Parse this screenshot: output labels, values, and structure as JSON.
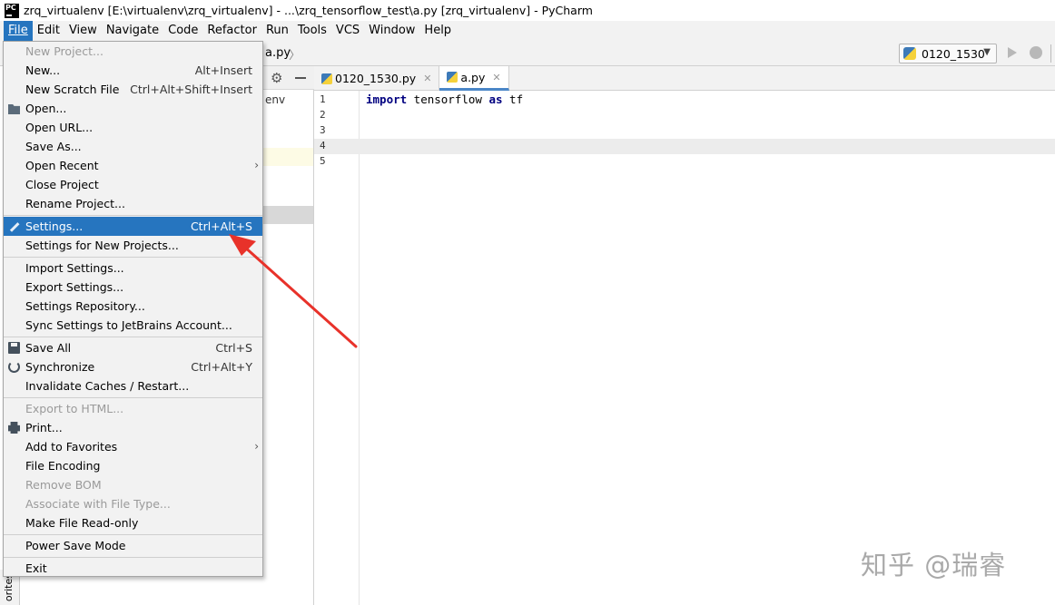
{
  "window": {
    "title": "zrq_virtualenv [E:\\virtualenv\\zrq_virtualenv] - ...\\zrq_tensorflow_test\\a.py [zrq_virtualenv] - PyCharm",
    "app_icon_text": "PC"
  },
  "menubar": {
    "items": [
      {
        "label": "File",
        "active": true
      },
      {
        "label": "Edit"
      },
      {
        "label": "View"
      },
      {
        "label": "Navigate"
      },
      {
        "label": "Code"
      },
      {
        "label": "Refactor"
      },
      {
        "label": "Run"
      },
      {
        "label": "Tools"
      },
      {
        "label": "VCS"
      },
      {
        "label": "Window"
      },
      {
        "label": "Help"
      }
    ]
  },
  "navbar": {
    "breadcrumb": "a.py",
    "run_config": "0120_1530"
  },
  "project_panel": {
    "partial_text": "env",
    "favorites_label": "orites"
  },
  "tabs": [
    {
      "label": "0120_1530.py",
      "active": false
    },
    {
      "label": "a.py",
      "active": true
    }
  ],
  "editor": {
    "line_numbers": [
      "1",
      "2",
      "3",
      "4",
      "5"
    ],
    "code_line_1": {
      "kw1": "import",
      "mid": " tensorflow ",
      "kw2": "as",
      "tail": " tf"
    }
  },
  "file_menu": {
    "items": [
      {
        "label": "New Project...",
        "disabled": true
      },
      {
        "label": "New...",
        "shortcut": "Alt+Insert"
      },
      {
        "label": "New Scratch File",
        "shortcut": "Ctrl+Alt+Shift+Insert"
      },
      {
        "label": "Open...",
        "icon": "folder-icon"
      },
      {
        "label": "Open URL..."
      },
      {
        "label": "Save As..."
      },
      {
        "label": "Open Recent",
        "submenu": true
      },
      {
        "label": "Close Project"
      },
      {
        "label": "Rename Project..."
      },
      {
        "label": "Settings...",
        "shortcut": "Ctrl+Alt+S",
        "selected": true,
        "icon": "wrench-icon"
      },
      {
        "label": "Settings for New Projects..."
      },
      {
        "label": "Import Settings..."
      },
      {
        "label": "Export Settings..."
      },
      {
        "label": "Settings Repository..."
      },
      {
        "label": "Sync Settings to JetBrains Account..."
      },
      {
        "label": "Save All",
        "shortcut": "Ctrl+S",
        "icon": "save-icon"
      },
      {
        "label": "Synchronize",
        "shortcut": "Ctrl+Alt+Y",
        "icon": "sync-icon"
      },
      {
        "label": "Invalidate Caches / Restart..."
      },
      {
        "label": "Export to HTML...",
        "disabled": true
      },
      {
        "label": "Print...",
        "icon": "print-icon"
      },
      {
        "label": "Add to Favorites",
        "submenu": true
      },
      {
        "label": "File Encoding"
      },
      {
        "label": "Remove BOM",
        "disabled": true
      },
      {
        "label": "Associate with File Type...",
        "disabled": true
      },
      {
        "label": "Make File Read-only"
      },
      {
        "label": "Power Save Mode"
      },
      {
        "label": "Exit"
      }
    ]
  },
  "watermark": "知乎 @瑞睿",
  "colors": {
    "menu_selected": "#2675bf",
    "annotation_arrow": "#e8322a",
    "tab_active_underline": "#4a86c7"
  }
}
